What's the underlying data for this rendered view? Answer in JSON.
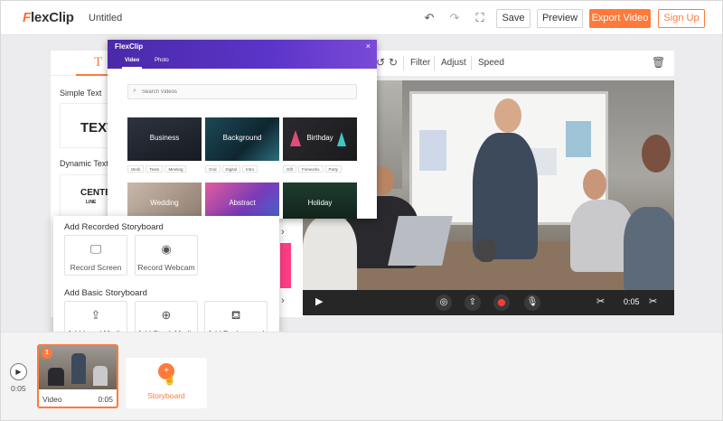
{
  "header": {
    "logo_prefix": "F",
    "logo_text": "lexClip",
    "project_title": "Untitled",
    "save_label": "Save",
    "preview_label": "Preview",
    "export_label": "Export Video",
    "signup_label": "Sign Up",
    "accent_color": "#ff7a3a"
  },
  "text_panel": {
    "tab_icon": "T",
    "simple_text_label": "Simple Text",
    "simple_text_sample": "TEXT",
    "dynamic_text_label": "Dynamic Text",
    "dynamic_text_sample": "CENTE",
    "dynamic_text_sub": "LINE"
  },
  "editor_toolbar": {
    "filter_label": "Filter",
    "adjust_label": "Adjust",
    "speed_label": "Speed"
  },
  "player": {
    "duration": "0:05"
  },
  "media_modal": {
    "logo": "FlexClip",
    "close": "×",
    "tabs": [
      "Video",
      "Photo"
    ],
    "search_placeholder": "Search Videos",
    "categories": [
      {
        "name": "Business",
        "tags": [
          "Work",
          "Team",
          "Meeting"
        ]
      },
      {
        "name": "Background",
        "tags": [
          "Grid",
          "Digital",
          "Intro"
        ]
      },
      {
        "name": "Birthday",
        "tags": [
          "Gift",
          "Fireworks",
          "Party"
        ]
      },
      {
        "name": "Wedding",
        "tags": []
      },
      {
        "name": "Abstract",
        "tags": []
      },
      {
        "name": "Holiday",
        "tags": []
      }
    ]
  },
  "storyboard_popup": {
    "recorded_heading": "Add Recorded Storyboard",
    "record_screen": "Record Screen",
    "record_webcam": "Record Webcam",
    "basic_heading": "Add Basic Storyboard",
    "add_local": "Add Local Media",
    "add_stock": "Add Stock Media",
    "add_background": "Add Background"
  },
  "timeline": {
    "time": "0:05",
    "clip_number": "1",
    "clip_label": "Video",
    "clip_duration": "0:05",
    "storyboard_label": "Storyboard"
  }
}
